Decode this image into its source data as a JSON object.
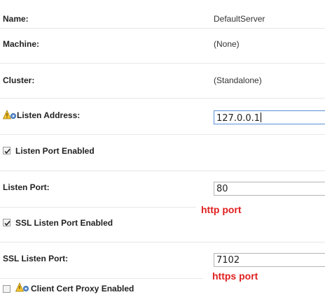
{
  "fields": {
    "name": {
      "label": "Name:",
      "value": "DefaultServer"
    },
    "machine": {
      "label": "Machine:",
      "value": "(None)"
    },
    "cluster": {
      "label": "Cluster:",
      "value": "(Standalone)"
    },
    "listen_address": {
      "label": "Listen Address:",
      "value": "127.0.0.1",
      "icon": "warning-restart-icon"
    },
    "listen_port_enabled": {
      "label": "Listen Port Enabled",
      "checked": true
    },
    "listen_port": {
      "label": "Listen Port:",
      "value": "80"
    },
    "ssl_listen_port_enabled": {
      "label": "SSL Listen Port Enabled",
      "checked": true
    },
    "ssl_listen_port": {
      "label": "SSL Listen Port:",
      "value": "7102"
    },
    "client_cert_proxy_enabled": {
      "label": "Client Cert Proxy Enabled",
      "checked": false,
      "icon": "warning-restart-icon"
    }
  },
  "annotations": {
    "http": "http port",
    "https": "https port",
    "color": "#e02020"
  }
}
